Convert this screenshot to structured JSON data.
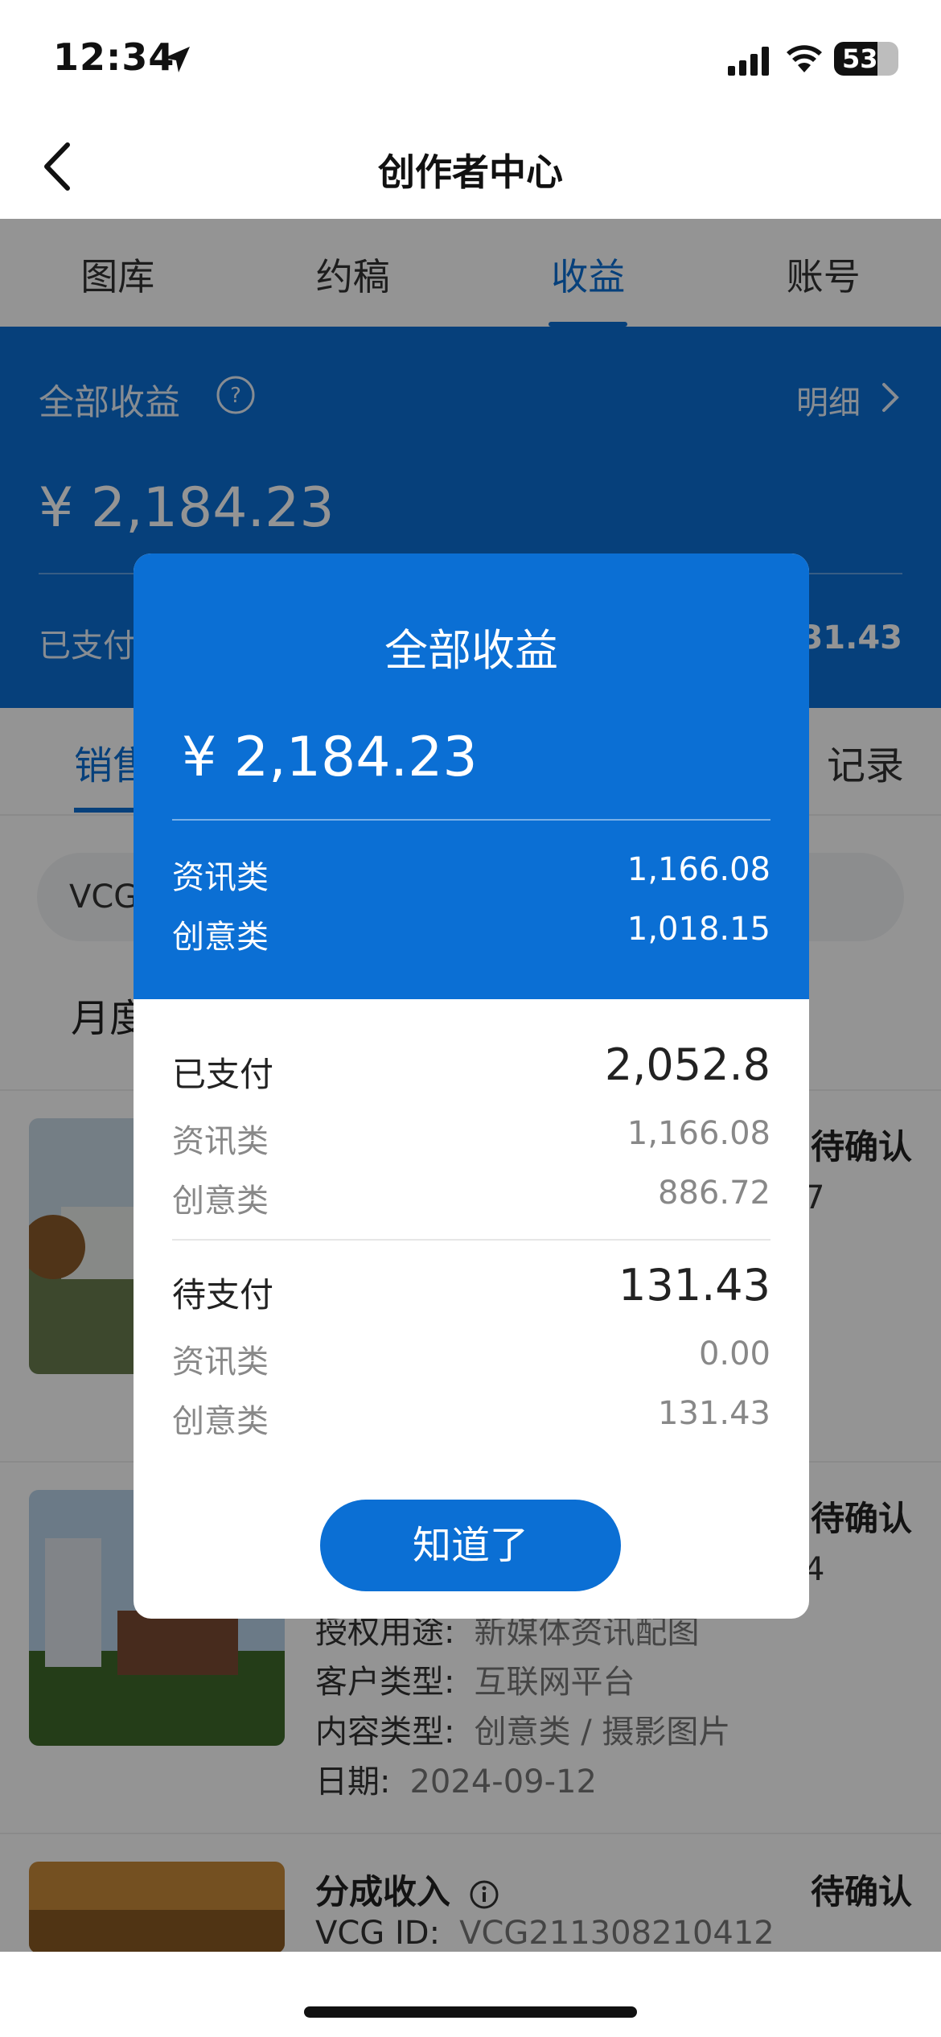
{
  "status_bar": {
    "time": "12:34",
    "battery": "53"
  },
  "nav": {
    "title": "创作者中心"
  },
  "tabs": [
    {
      "label": "图库",
      "active": false
    },
    {
      "label": "约稿",
      "active": false
    },
    {
      "label": "收益",
      "active": true
    },
    {
      "label": "账号",
      "active": false
    }
  ],
  "earnings": {
    "title": "全部收益",
    "detail_link": "明细",
    "amount": "¥ 2,184.23",
    "paid_label_visible": "已支付",
    "pending_value_visible": "31.43"
  },
  "sub_tabs": {
    "left_visible": "销售",
    "right_visible": "记录"
  },
  "search": {
    "text_visible": "VCG"
  },
  "month_label_visible": "月度",
  "cards": [
    {
      "status": "待确认",
      "status_value_fragment": "7"
    },
    {
      "status": "待确认",
      "id_fragment": "4",
      "usage_label": "授权用途:",
      "usage_value": "新媒体资讯配图",
      "client_label": "客户类型:",
      "client_value": "互联网平台",
      "content_label": "内容类型:",
      "content_value": "创意类 / 摄影图片",
      "date_label": "日期:",
      "date_value": "2024-09-12"
    },
    {
      "title": "分成收入",
      "status": "待确认",
      "id_label": "VCG ID:",
      "id_value": "VCG211308210412"
    }
  ],
  "modal": {
    "title": "全部收益",
    "amount": "¥ 2,184.23",
    "breakdown": [
      {
        "label": "资讯类",
        "value": "1,166.08"
      },
      {
        "label": "创意类",
        "value": "1,018.15"
      }
    ],
    "paid": {
      "label": "已支付",
      "total": "2,052.8",
      "items": [
        {
          "label": "资讯类",
          "value": "1,166.08"
        },
        {
          "label": "创意类",
          "value": "886.72"
        }
      ]
    },
    "pending": {
      "label": "待支付",
      "total": "131.43",
      "items": [
        {
          "label": "资讯类",
          "value": "0.00"
        },
        {
          "label": "创意类",
          "value": "131.43"
        }
      ]
    },
    "button_label": "知道了"
  },
  "colors": {
    "accent": "#0b6fd4",
    "overlay": "rgba(0,0,0,0.42)"
  }
}
